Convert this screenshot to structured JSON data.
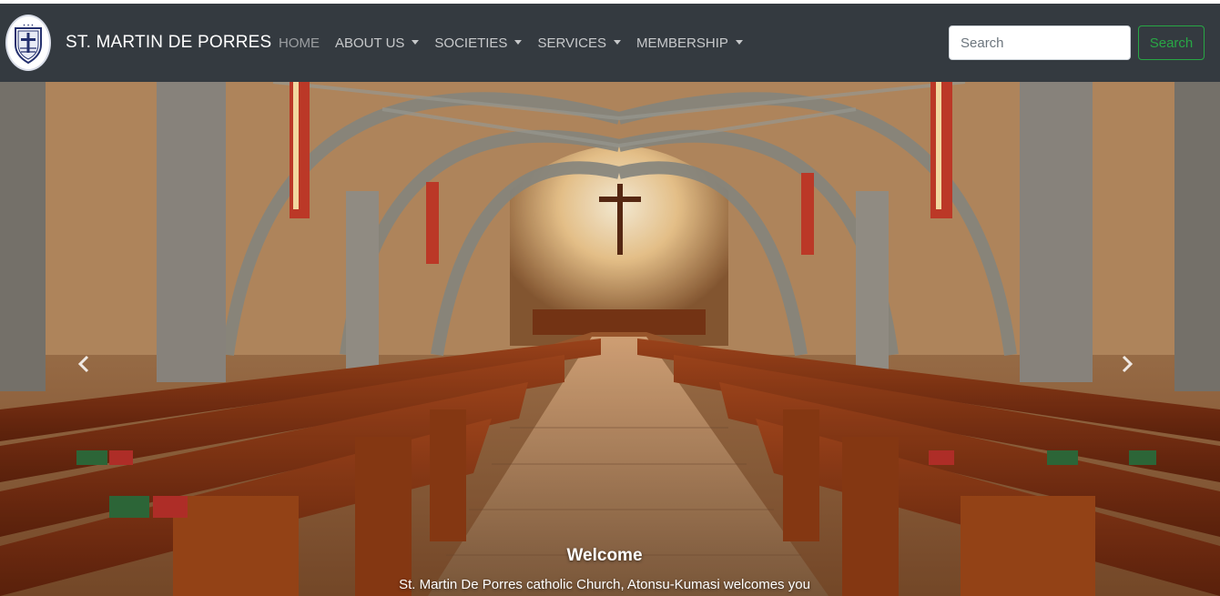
{
  "brand": {
    "name": "ST. MARTIN DE PORRES",
    "logo_icon": "church-crest-logo"
  },
  "nav": {
    "items": [
      {
        "label": "HOME",
        "active": true,
        "dropdown": false
      },
      {
        "label": "ABOUT US",
        "active": false,
        "dropdown": true
      },
      {
        "label": "SOCIETIES",
        "active": false,
        "dropdown": true
      },
      {
        "label": "SERVICES",
        "active": false,
        "dropdown": true
      },
      {
        "label": "MEMBERSHIP",
        "active": false,
        "dropdown": true
      }
    ]
  },
  "search": {
    "placeholder": "Search",
    "value": "",
    "button_label": "Search"
  },
  "carousel": {
    "prev_icon": "chevron-left-icon",
    "next_icon": "chevron-right-icon",
    "slide": {
      "image": "church-interior-with-pews",
      "caption_title": "Welcome",
      "caption_text": "St. Martin De Porres catholic Church, Atonsu-Kumasi welcomes you"
    }
  },
  "colors": {
    "navbar": "#343a40",
    "search_button": "#28a745"
  }
}
